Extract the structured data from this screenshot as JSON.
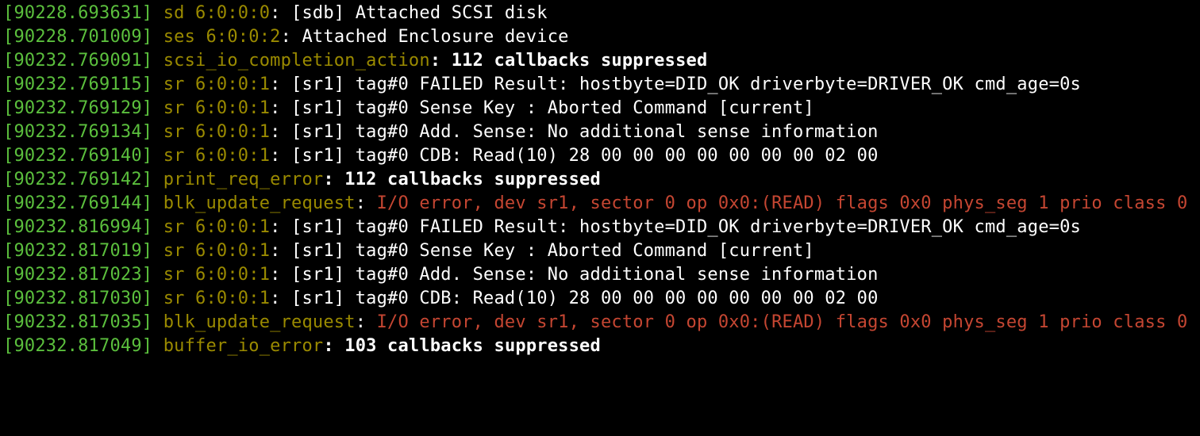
{
  "colors": {
    "timestamp": "#5bbf3d",
    "source": "#9a8a00",
    "text": "#ffffff",
    "error": "#c54632",
    "background": "#000000"
  },
  "lines": [
    {
      "ts": "90228.693631",
      "segments": [
        {
          "class": "src",
          "text": "sd 6:0:0:0"
        },
        {
          "class": "white",
          "text": ": [sdb] Attached SCSI disk"
        }
      ]
    },
    {
      "ts": "90228.701009",
      "segments": [
        {
          "class": "src",
          "text": "ses 6:0:0:2"
        },
        {
          "class": "white",
          "text": ": Attached Enclosure device"
        }
      ]
    },
    {
      "ts": "90232.769091",
      "segments": [
        {
          "class": "src",
          "text": "scsi_io_completion_action"
        },
        {
          "class": "white bold",
          "text": ": 112 callbacks suppressed"
        }
      ]
    },
    {
      "ts": "90232.769115",
      "segments": [
        {
          "class": "src",
          "text": "sr 6:0:0:1"
        },
        {
          "class": "white",
          "text": ": [sr1] tag#0 FAILED Result: hostbyte=DID_OK driverbyte=DRIVER_OK cmd_age=0s"
        }
      ]
    },
    {
      "ts": "90232.769129",
      "segments": [
        {
          "class": "src",
          "text": "sr 6:0:0:1"
        },
        {
          "class": "white",
          "text": ": [sr1] tag#0 Sense Key : Aborted Command [current]"
        }
      ]
    },
    {
      "ts": "90232.769134",
      "segments": [
        {
          "class": "src",
          "text": "sr 6:0:0:1"
        },
        {
          "class": "white",
          "text": ": [sr1] tag#0 Add. Sense: No additional sense information"
        }
      ]
    },
    {
      "ts": "90232.769140",
      "segments": [
        {
          "class": "src",
          "text": "sr 6:0:0:1"
        },
        {
          "class": "white",
          "text": ": [sr1] tag#0 CDB: Read(10) 28 00 00 00 00 00 00 00 02 00"
        }
      ]
    },
    {
      "ts": "90232.769142",
      "segments": [
        {
          "class": "src",
          "text": "print_req_error"
        },
        {
          "class": "white bold",
          "text": ": 112 callbacks suppressed"
        }
      ]
    },
    {
      "ts": "90232.769144",
      "segments": [
        {
          "class": "src",
          "text": "blk_update_request"
        },
        {
          "class": "white",
          "text": ": "
        },
        {
          "class": "err",
          "text": "I/O error, dev sr1, sector 0 op 0x0:(READ) flags 0x0 phys_seg 1 prio class 0"
        }
      ]
    },
    {
      "ts": "90232.816994",
      "segments": [
        {
          "class": "src",
          "text": "sr 6:0:0:1"
        },
        {
          "class": "white",
          "text": ": [sr1] tag#0 FAILED Result: hostbyte=DID_OK driverbyte=DRIVER_OK cmd_age=0s"
        }
      ]
    },
    {
      "ts": "90232.817019",
      "segments": [
        {
          "class": "src",
          "text": "sr 6:0:0:1"
        },
        {
          "class": "white",
          "text": ": [sr1] tag#0 Sense Key : Aborted Command [current]"
        }
      ]
    },
    {
      "ts": "90232.817023",
      "segments": [
        {
          "class": "src",
          "text": "sr 6:0:0:1"
        },
        {
          "class": "white",
          "text": ": [sr1] tag#0 Add. Sense: No additional sense information"
        }
      ]
    },
    {
      "ts": "90232.817030",
      "segments": [
        {
          "class": "src",
          "text": "sr 6:0:0:1"
        },
        {
          "class": "white",
          "text": ": [sr1] tag#0 CDB: Read(10) 28 00 00 00 00 00 00 00 02 00"
        }
      ]
    },
    {
      "ts": "90232.817035",
      "segments": [
        {
          "class": "src",
          "text": "blk_update_request"
        },
        {
          "class": "white",
          "text": ": "
        },
        {
          "class": "err",
          "text": "I/O error, dev sr1, sector 0 op 0x0:(READ) flags 0x0 phys_seg 1 prio class 0"
        }
      ]
    },
    {
      "ts": "90232.817049",
      "segments": [
        {
          "class": "src",
          "text": "buffer_io_error"
        },
        {
          "class": "white bold",
          "text": ": 103 callbacks suppressed"
        }
      ]
    }
  ]
}
